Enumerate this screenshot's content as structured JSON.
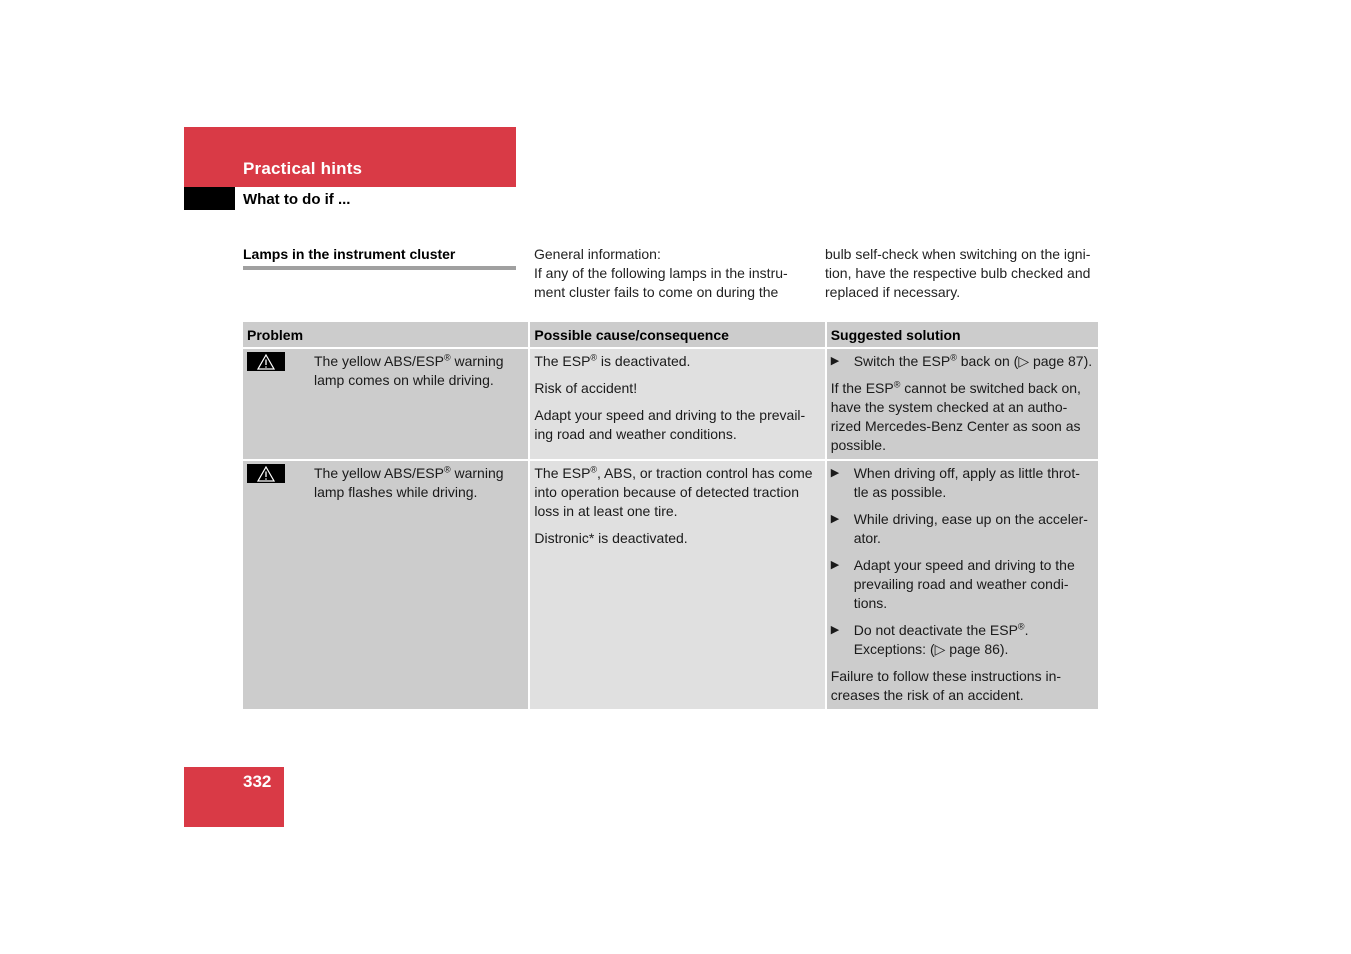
{
  "header": {
    "chapter": "Practical hints",
    "subtitle": "What to do if ..."
  },
  "section": {
    "title": "Lamps in the instrument cluster",
    "intro_col1": [
      "General information:",
      "If any of the following lamps in the instru-",
      "ment cluster fails to come on during the"
    ],
    "intro_col2": [
      "bulb self-check when switching on the igni-",
      "tion, have the respective bulb checked and",
      "replaced if necessary."
    ]
  },
  "table": {
    "headers": {
      "problem": "Problem",
      "cause": "Possible cause/consequence",
      "solution": "Suggested solution"
    },
    "rows": [
      {
        "icon": "warning-triangle-icon",
        "problem_pre": "The yellow ABS/ESP",
        "problem_sup": "®",
        "problem_post": " warning lamp comes on while driving.",
        "cause": [
          {
            "pre": "The ESP",
            "sup": "®",
            "post": " is deactivated."
          },
          {
            "pre": "Risk of accident!",
            "sup": "",
            "post": ""
          },
          {
            "pre": "Adapt your speed and driving to the prevail-ing road and weather conditions.",
            "sup": "",
            "post": ""
          }
        ],
        "solution_bullets": [
          {
            "pre": "Switch the ESP",
            "sup": "®",
            "post": " back on (▷ page 87)."
          }
        ],
        "solution_note": {
          "pre": "If the ESP",
          "sup": "®",
          "post": " cannot be switched back on, have the system checked at an autho-rized Mercedes-Benz Center as soon as possible."
        }
      },
      {
        "icon": "warning-triangle-icon",
        "problem_pre": "The yellow ABS/ESP",
        "problem_sup": "®",
        "problem_post": " warning lamp flashes while driving.",
        "cause": [
          {
            "pre": "The ESP",
            "sup": "®",
            "post": ", ABS, or traction control has come into operation because of detected traction loss in at least one tire."
          },
          {
            "pre": "Distronic* is deactivated.",
            "sup": "",
            "post": ""
          }
        ],
        "solution_bullets": [
          {
            "pre": "When driving off, apply as little throt-tle as possible.",
            "sup": "",
            "post": ""
          },
          {
            "pre": "While driving, ease up on the acceler-ator.",
            "sup": "",
            "post": ""
          },
          {
            "pre": "Adapt your speed and driving to the prevailing road and weather condi-tions.",
            "sup": "",
            "post": ""
          },
          {
            "pre": "Do not deactivate the ESP",
            "sup": "®",
            "post": ". Exceptions: (▷ page 86)."
          }
        ],
        "solution_note": {
          "pre": "Failure to follow these instructions in-creases the risk of an accident.",
          "sup": "",
          "post": ""
        }
      }
    ],
    "bullet_glyph": "▶"
  },
  "footer": {
    "page_number": "332"
  }
}
